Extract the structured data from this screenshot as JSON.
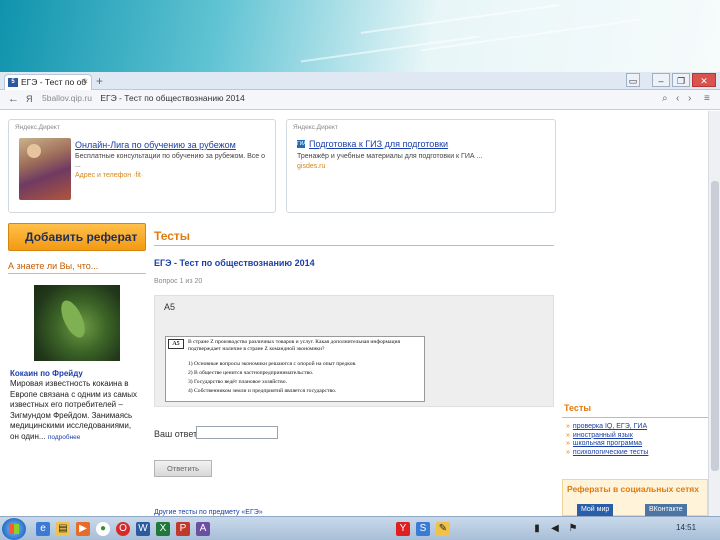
{
  "browser": {
    "tab_title": "ЕГЭ - Тест по об",
    "tab_close": "×",
    "new_tab": "+",
    "window_controls": [
      "▭",
      "–",
      "❐",
      "✕"
    ],
    "back": "←",
    "reload": "Я",
    "url_domain": "5ballov.qip.ru",
    "url_title": "ЕГЭ - Тест по обществознанию 2014"
  },
  "ads": [
    {
      "label": "Яндекс.Директ",
      "title": "Онлайн-Лига по обучению за рубежом",
      "text": "Бесплатные консультации по обучению за рубежом. Все о ...",
      "url": "Адрес и телефон ·fit·"
    },
    {
      "label": "Яндекс.Директ",
      "title": "Подготовка к ГИЗ для подготовки",
      "text": "Тренажёр и учебные материалы для подготовки к ГИА ...",
      "url": "gisdes.ru"
    }
  ],
  "left": {
    "add_button": "Добавить реферат",
    "know_title": "А знаете ли Вы, что...",
    "fact_title": "Кокаин по Фрейду",
    "fact_text": "Мировая известность кокаина в Европе связана с одним из самых известных его потребителей – Зигмундом Фрейдом. Занимаясь медицинскими исследованиями, он один...",
    "more_link": "подробнее"
  },
  "main": {
    "section_title": "Тесты",
    "test_title": "ЕГЭ - Тест по обществознанию 2014",
    "question_counter": "Вопрос 1 из 20",
    "question_label": "А5",
    "question_tag": "А5",
    "question_text": "В стране Z производство различных товаров и услуг. Какая дополнительная информация подтверждает наличие в стране Z командной экономики?",
    "options": [
      "1) Основные вопросы экономики решаются с опорой на опыт предков.",
      "2) В обществе ценится частнопредпринимательство.",
      "3) Государство ведёт плановое хозяйство.",
      "4) Собственником земли и предприятий является государство."
    ],
    "answer_label": "Ваш ответ:",
    "answer_value": "",
    "submit_label": "Ответить",
    "bottom_link": "Другие тесты по предмету «ЕГЭ»"
  },
  "right": {
    "title": "Тесты",
    "links": [
      "проверка IQ, ЕГЭ, ГИА",
      "иностранный язык",
      "школьная программа",
      "психологические тесты"
    ],
    "social_title": "Рефераты в социальных сетях",
    "social_buttons": [
      "Мой мир",
      "ВКонтакте"
    ]
  },
  "taskbar": {
    "clock": "14:51",
    "icons": [
      "ie-icon",
      "folder-icon",
      "media-icon",
      "chrome-icon",
      "opera-icon",
      "word-icon",
      "excel-icon"
    ]
  }
}
